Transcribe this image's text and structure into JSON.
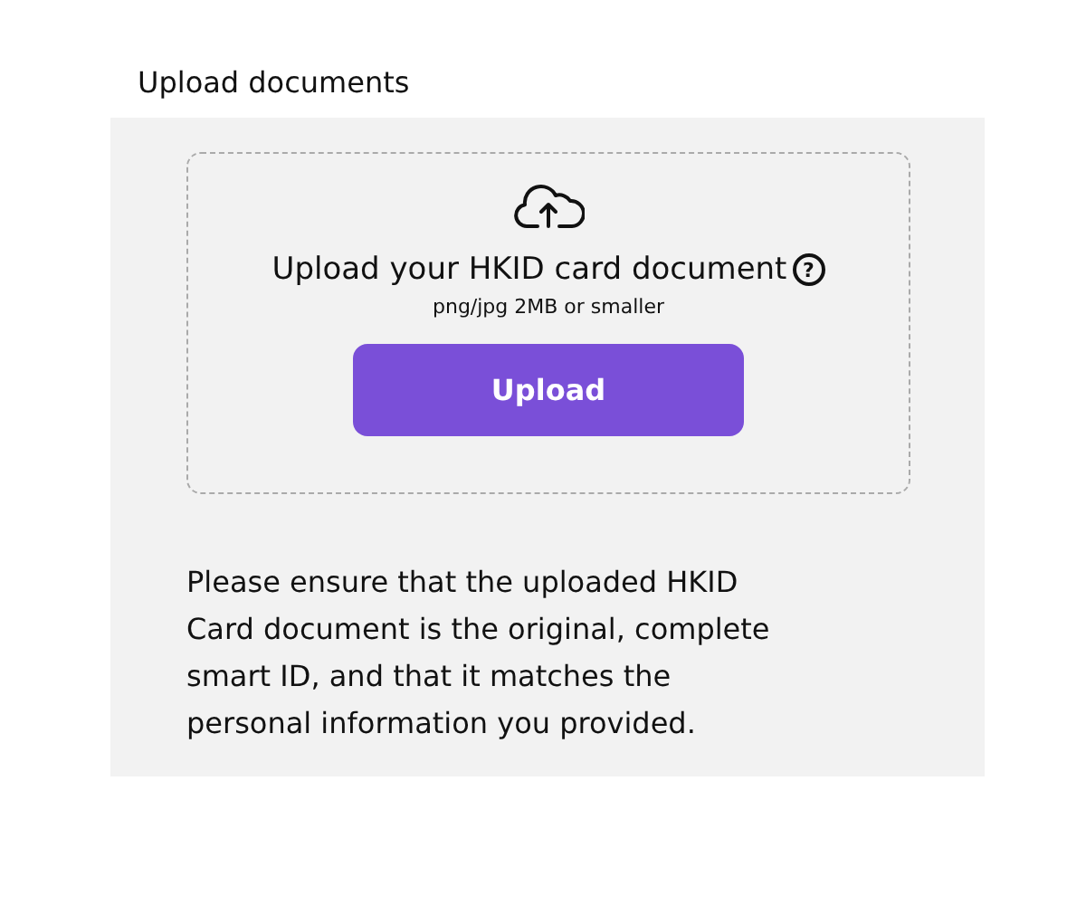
{
  "heading": "Upload documents",
  "dropzone": {
    "title": "Upload your HKID card document",
    "help_icon": "?",
    "hint": "png/jpg 2MB or smaller",
    "button": "Upload"
  },
  "note": "Please ensure that the uploaded HKID Card document is the original, complete smart ID, and that it matches the personal information you provided."
}
